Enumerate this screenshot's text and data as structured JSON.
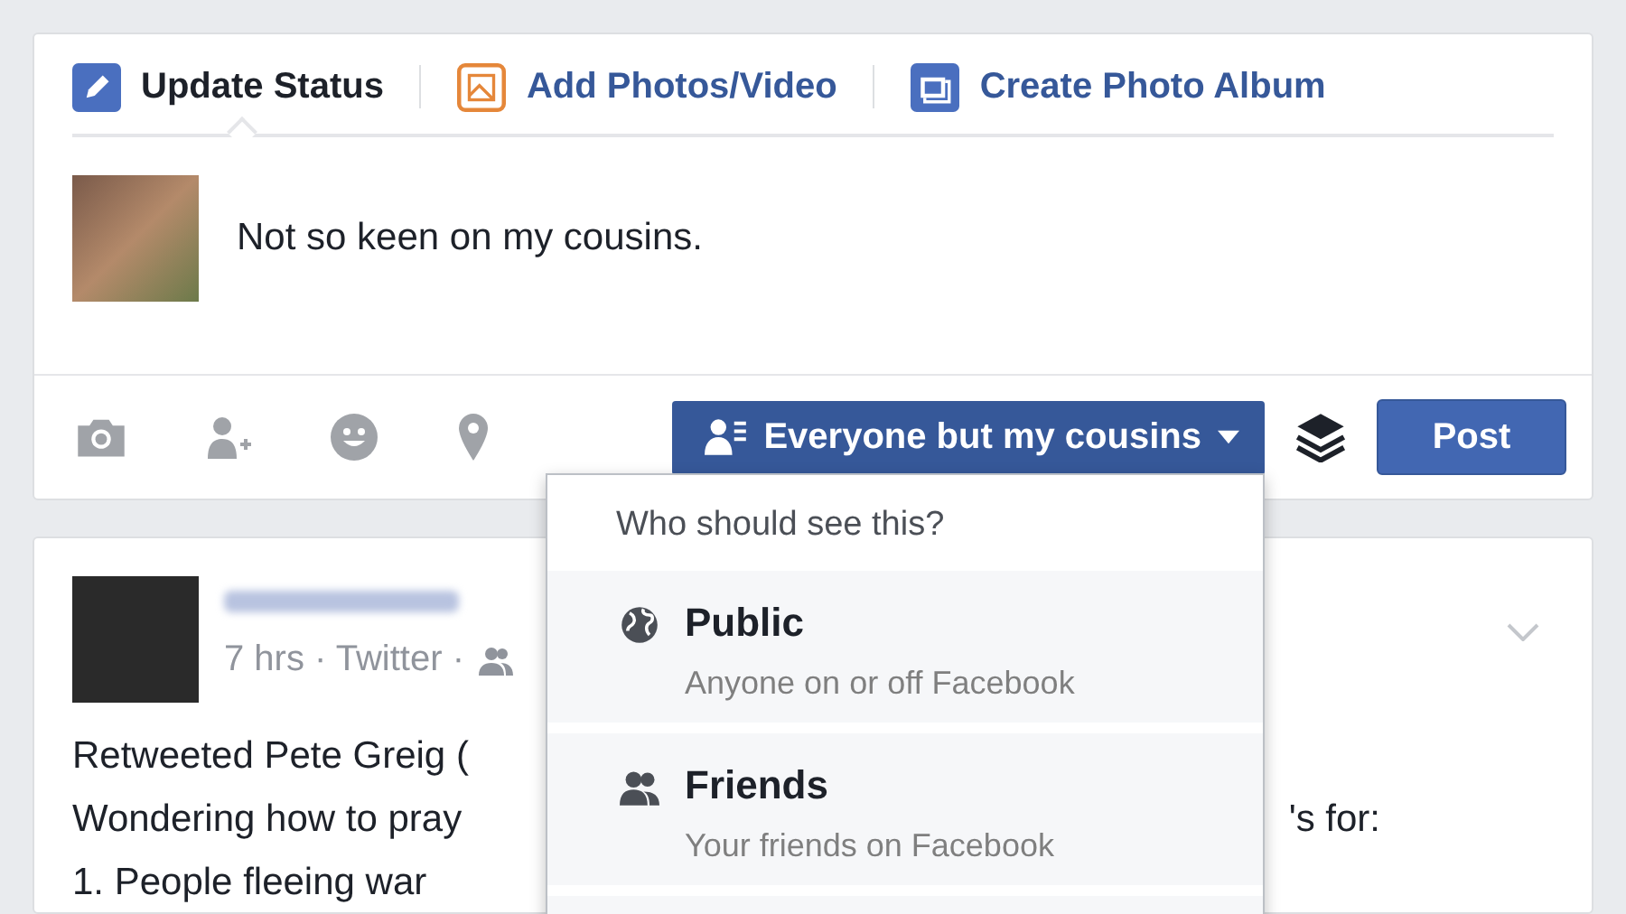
{
  "composer": {
    "tabs": [
      {
        "label": "Update Status",
        "kind": "status",
        "selected": true
      },
      {
        "label": "Add Photos/Video",
        "kind": "photo",
        "selected": false
      },
      {
        "label": "Create Photo Album",
        "kind": "album",
        "selected": false
      }
    ],
    "text": "Not so keen on my cousins.",
    "audience_button": "Everyone but my cousins",
    "post_button": "Post"
  },
  "audience_menu": {
    "header": "Who should see this?",
    "items": [
      {
        "title": "Public",
        "subtitle": "Anyone on or off Facebook",
        "kind": "public",
        "selected": false
      },
      {
        "title": "Friends",
        "subtitle": "Your friends on Facebook",
        "kind": "friends",
        "selected": false
      }
    ]
  },
  "post": {
    "meta": "7 hrs · Twitter ·",
    "lines": [
      {
        "left": "Retweeted Pete Greig ("
      },
      {
        "left": "Wondering how to pray",
        "right": "'s for:"
      },
      {
        "left": "1. People fleeing war"
      }
    ]
  }
}
